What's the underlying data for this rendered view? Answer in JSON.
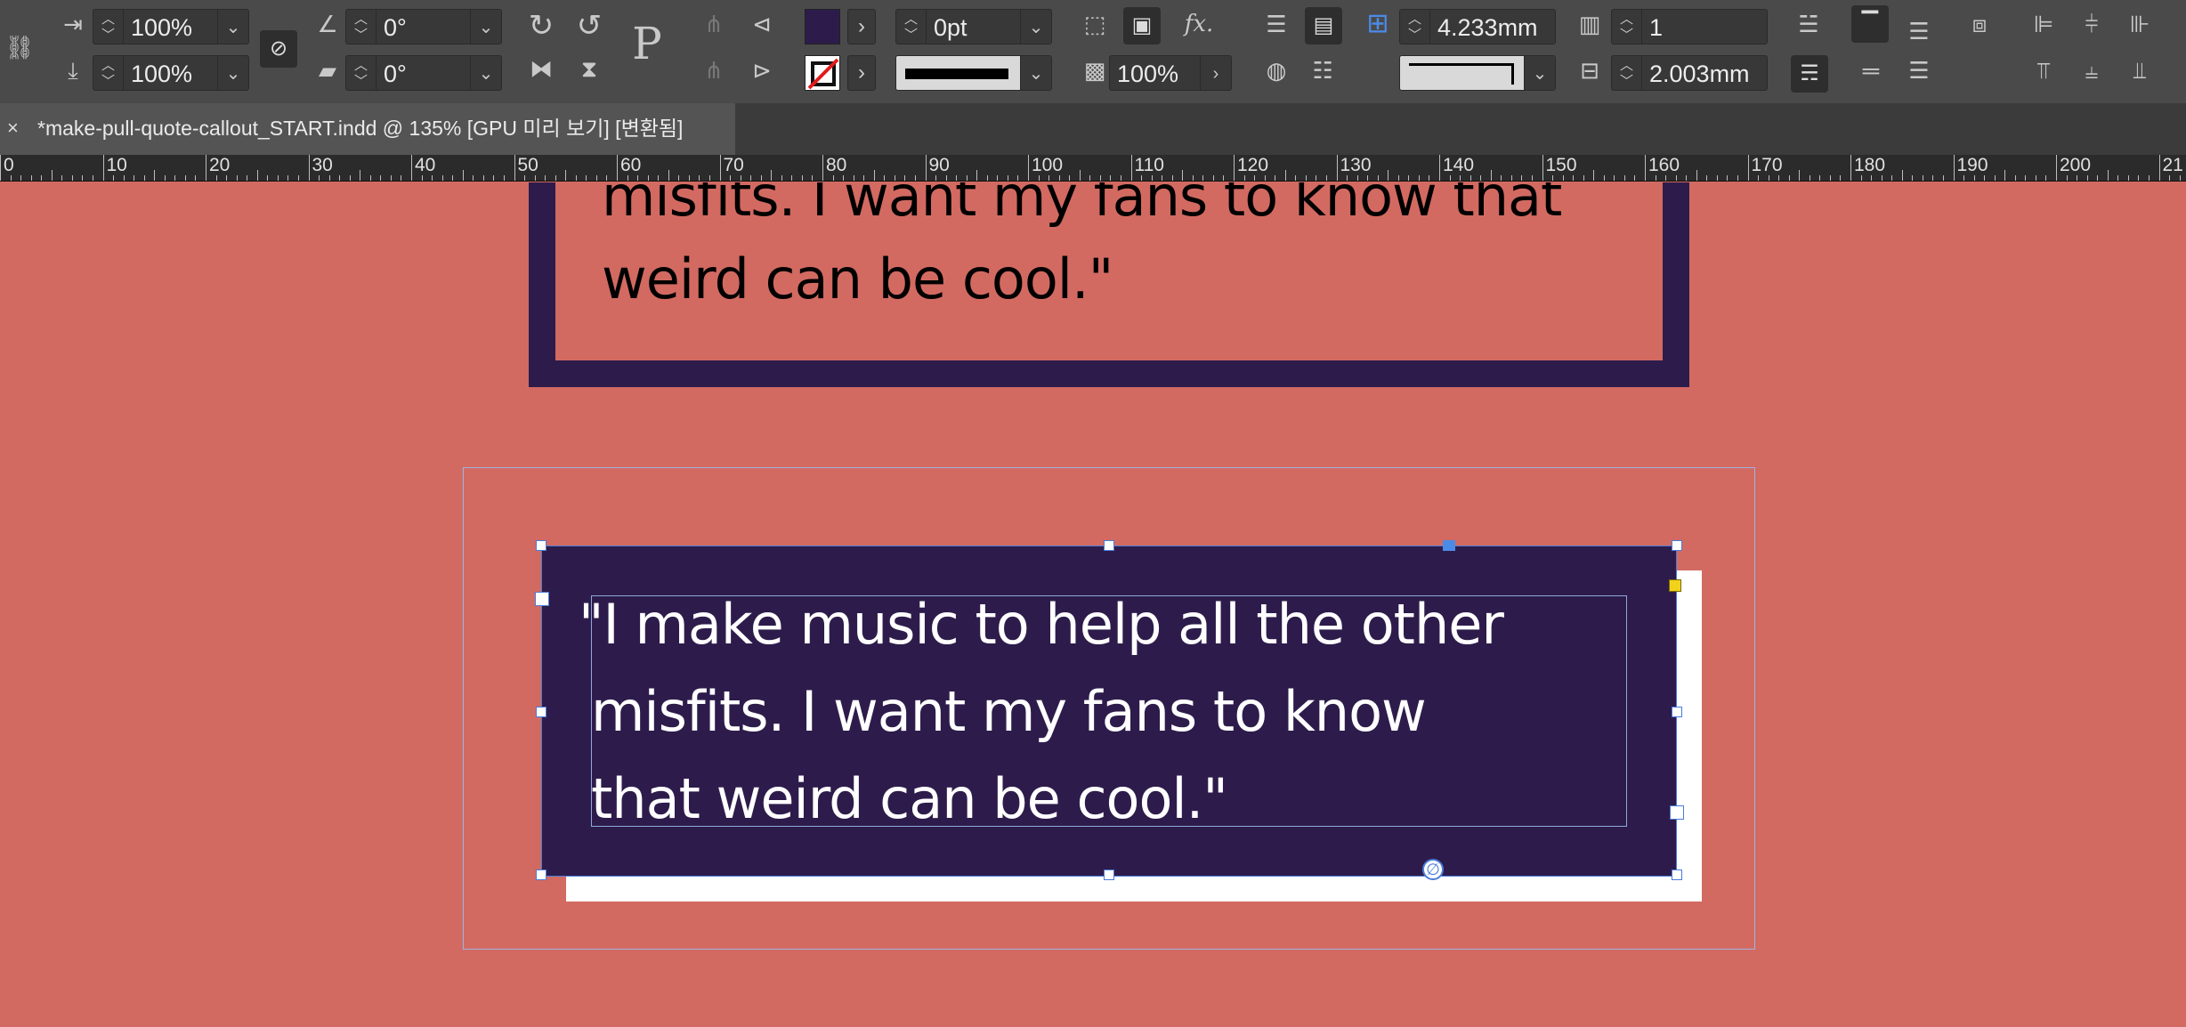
{
  "control_bar": {
    "scale_x": "100%",
    "scale_y": "100%",
    "rotation": "0°",
    "shear": "0°",
    "stroke_weight": "0pt",
    "opacity": "100%",
    "inset_spacing": "4.233mm",
    "columns": "1",
    "column_gutter": "2.003mm",
    "fill_swatch_color": "#2d1c4b",
    "icons": {
      "constrain": "link-break-icon",
      "rotate": "rotate-icon",
      "shear": "shear-icon",
      "fx": "fx-icon"
    },
    "fx_label": "fx."
  },
  "tab": {
    "close_glyph": "×",
    "title": "*make-pull-quote-callout_START.indd @ 135% [GPU 미리 보기] [변환됨]"
  },
  "ruler": {
    "labels": [
      "0",
      "10",
      "20",
      "30",
      "40",
      "50",
      "60",
      "70",
      "80",
      "90",
      "100",
      "110",
      "120",
      "130",
      "140",
      "150",
      "160",
      "170",
      "180",
      "190",
      "200",
      "21"
    ]
  },
  "canvas": {
    "background_color": "#d26a62",
    "upper_quote": {
      "line1": "misfits. I want my fans to know that",
      "line2": "weird can be cool.\""
    },
    "lower_quote": {
      "line1": "\"I make music to help all the other",
      "line2": "misfits. I want my fans to know",
      "line3": "that weird can be cool.\""
    },
    "frame_color": "#2d1c4b",
    "shadow_color": "#ffffff"
  }
}
